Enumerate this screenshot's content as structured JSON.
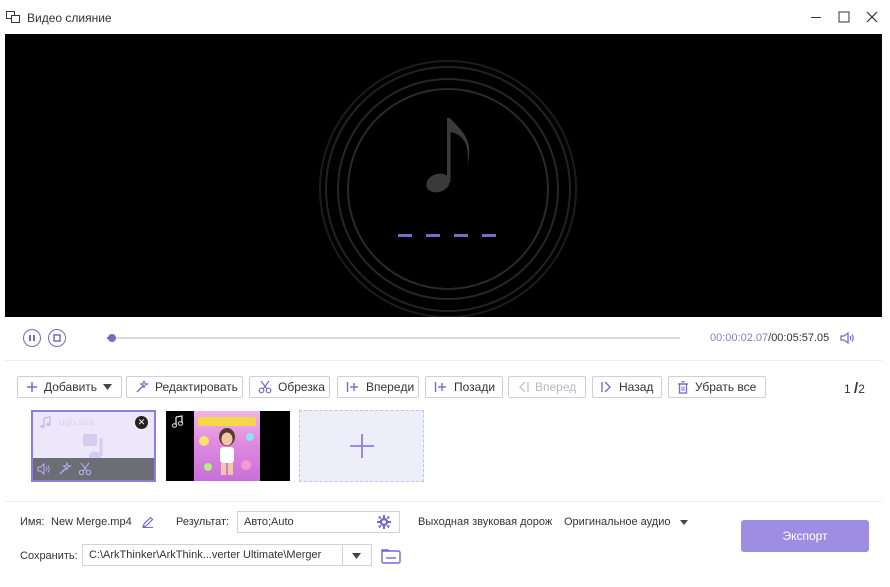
{
  "window": {
    "title": "Видео слияние",
    "icon": "merge-app-icon"
  },
  "preview": {
    "icon": "music-note-icon",
    "accent": "#7c68c8"
  },
  "player": {
    "current_time": "00:00:02.07",
    "separator": "/",
    "total_time": "00:05:57.05",
    "progress": 0.006
  },
  "toolbar": {
    "add_label": "Добавить",
    "edit_label": "Редактировать",
    "trim_label": "Обрезка",
    "forward_label": "Вперeди",
    "behind_label": "Позади",
    "prev_label": "Вперед",
    "back_label": "Назад",
    "remove_all_label": "Убрать все",
    "page_current": "1",
    "page_sep": "/",
    "page_total": "2"
  },
  "clips": [
    {
      "name": "ugo.ssa",
      "selected": true,
      "type": "audio"
    },
    {
      "name": "",
      "selected": false,
      "type": "video"
    }
  ],
  "settings": {
    "name_label": "Имя:",
    "name_value": "New Merge.mp4",
    "result_label": "Результат:",
    "result_value": "Авто;Auto",
    "audio_label": "Выходная звуковая дорожк",
    "audio_value": "Оригинальное аудио",
    "save_label": "Сохранить:",
    "save_path": "C:\\ArkThinker\\ArkThink...verter Ultimate\\Merger",
    "export_label": "Экспорт"
  },
  "colors": {
    "accent": "#7c68c8",
    "export_bg": "#9e8ee3",
    "preview_bg": "#000000"
  }
}
